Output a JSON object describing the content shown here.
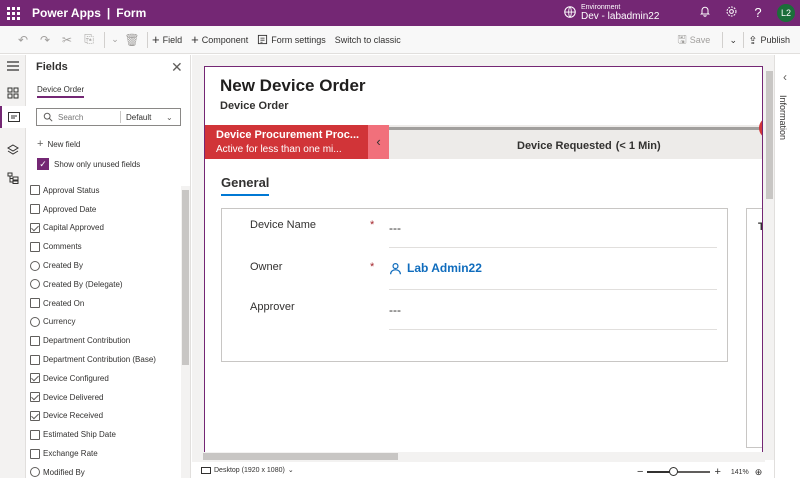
{
  "header": {
    "app_name": "Power Apps",
    "separator": "|",
    "page": "Form",
    "environment_label": "Environment",
    "environment_name": "Dev - labadmin22",
    "avatar_initials": "L2"
  },
  "commands": {
    "field": "Field",
    "component": "Component",
    "form_settings": "Form settings",
    "switch_classic": "Switch to classic",
    "save": "Save",
    "publish": "Publish"
  },
  "fields_panel": {
    "title": "Fields",
    "tab": "Device Order",
    "search_placeholder": "Search",
    "filter_value": "Default",
    "new_field": "New field",
    "show_unused": "Show only unused fields",
    "items": [
      {
        "label": "Approval Status",
        "icon": "option-set-icon"
      },
      {
        "label": "Approved Date",
        "icon": "date-icon"
      },
      {
        "label": "Capital Approved",
        "icon": "checkbox-icon"
      },
      {
        "label": "Comments",
        "icon": "text-icon"
      },
      {
        "label": "Created By",
        "icon": "lookup-icon"
      },
      {
        "label": "Created By (Delegate)",
        "icon": "lookup-icon"
      },
      {
        "label": "Created On",
        "icon": "date-icon"
      },
      {
        "label": "Currency",
        "icon": "lookup-icon"
      },
      {
        "label": "Department Contribution",
        "icon": "currency-icon"
      },
      {
        "label": "Department Contribution (Base)",
        "icon": "currency-icon"
      },
      {
        "label": "Device Configured",
        "icon": "checkbox-icon"
      },
      {
        "label": "Device Delivered",
        "icon": "checkbox-icon"
      },
      {
        "label": "Device Received",
        "icon": "checkbox-icon"
      },
      {
        "label": "Estimated Ship Date",
        "icon": "date-icon"
      },
      {
        "label": "Exchange Rate",
        "icon": "number-icon"
      },
      {
        "label": "Modified By",
        "icon": "lookup-icon"
      }
    ]
  },
  "form": {
    "title": "New Device Order",
    "subtitle": "Device Order",
    "bpf_stage_name": "Device Procurement Proc...",
    "bpf_active": "Active for less than one mi...",
    "bpf_requested": "Device Requested",
    "bpf_time": "(< 1 Min)",
    "tab_general": "General",
    "rows": [
      {
        "label": "Device Name",
        "required": "*",
        "value": "---"
      },
      {
        "label": "Owner",
        "required": "*",
        "value": "Lab Admin22"
      },
      {
        "label": "Approver",
        "required": "",
        "value": "---"
      }
    ],
    "side_section_letter": "T"
  },
  "right_panel": {
    "label": "Information"
  },
  "statusbar": {
    "device": "Desktop (1920 x 1080)",
    "zoom": "141%"
  },
  "colors": {
    "brand": "#742774",
    "bpf_active": "#d13438",
    "link": "#0f6cbd"
  }
}
